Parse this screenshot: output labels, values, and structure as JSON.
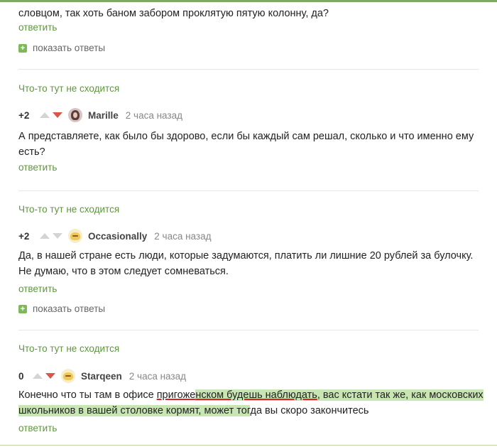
{
  "top_comment": {
    "text_tail": "словцом, так хоть баном забором проклятую пятую колонну, да?",
    "reply_label": "ответить",
    "show_replies_label": "показать ответы"
  },
  "comments": [
    {
      "branch_label": "Что-то тут не сходится",
      "rating": "+2",
      "username": "Marille",
      "time": "2 часа назад",
      "text": "А представляете, как было бы здорово, если бы каждый сам решал, сколько и что именно ему есть?",
      "reply_label": "ответить"
    },
    {
      "branch_label": "Что-то тут не сходится",
      "rating": "+2",
      "username": "Occasionally",
      "time": "2 часа назад",
      "text": "Да, в нашей стране есть люди, которые задумаются, платить ли лишние 20 рублей за булочку. Не думаю, что в этом следует сомневаться.",
      "reply_label": "ответить",
      "show_replies_label": "показать ответы"
    },
    {
      "branch_label": "Что-то тут не сходится",
      "rating": "0",
      "username": "Starqeen",
      "time": "2 часа назад",
      "text_parts": {
        "p1": "Конечно что ты там в офисе ",
        "p2": "пригоже",
        "p3": "нском будешь наблюдать",
        "p4": ", вас кстати так же, как московских",
        "p5": "школьников в вашей столовке кормят, может тог",
        "p6": "да вы скоро закончитесь"
      },
      "reply_label": "ответить"
    }
  ],
  "colors": {
    "accent_green": "#5f9640",
    "downvote_red": "#d7584a",
    "highlight": "#c8e6b4"
  },
  "icons": {
    "plus": "+"
  }
}
